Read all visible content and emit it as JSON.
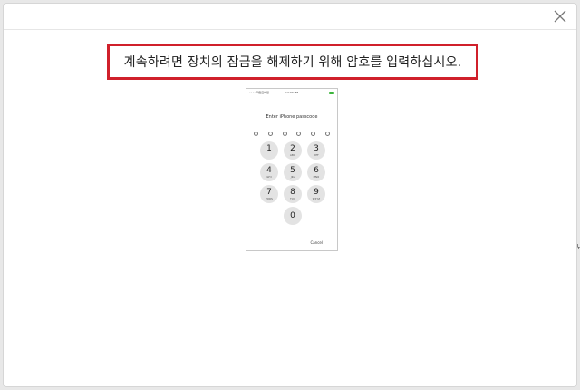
{
  "dialog": {
    "close_icon": "close-icon",
    "message": "계속하려면 장치의 잠금을 해제하기 위해 암호를 입력하십시오.",
    "highlight_color": "#d0202b",
    "edge_glyph": "뇨"
  },
  "phone": {
    "status": {
      "carrier": "•••• 파일모바일 ",
      "time": "12:00 PM",
      "battery_color": "#3db53d"
    },
    "prompt": "Enter iPhone passcode",
    "passcode_length": 6,
    "keys": [
      {
        "num": "1",
        "letters": ""
      },
      {
        "num": "2",
        "letters": "ABC"
      },
      {
        "num": "3",
        "letters": "DEF"
      },
      {
        "num": "4",
        "letters": "GHI"
      },
      {
        "num": "5",
        "letters": "JKL"
      },
      {
        "num": "6",
        "letters": "MNO"
      },
      {
        "num": "7",
        "letters": "PQRS"
      },
      {
        "num": "8",
        "letters": "TUV"
      },
      {
        "num": "9",
        "letters": "WXYZ"
      },
      {
        "num": "0",
        "letters": ""
      }
    ],
    "cancel": "Cancel"
  }
}
